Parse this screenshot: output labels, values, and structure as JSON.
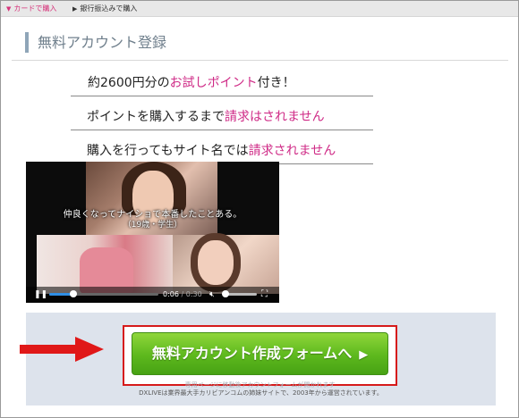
{
  "tabs": {
    "card": "カードで購入",
    "bank": "銀行振込みで購入"
  },
  "heading": "無料アカウント登録",
  "features": {
    "f1_pre": "約2600円分の",
    "f1_hl": "お試しポイント",
    "f1_post": "付き！",
    "f2_pre": "ポイントを購入するまで",
    "f2_hl": "請求はされません",
    "f3_pre": "購入を行ってもサイト名では",
    "f3_hl": "請求されません"
  },
  "video": {
    "subtitle_line1": "仲良くなってナイショで本番したことある。",
    "subtitle_line2": "（19歳・学生）",
    "time_current": "0:06",
    "time_separator": " / ",
    "time_total": "0:30",
    "progress": 0.22,
    "volume": 0.08,
    "icons": [
      "pause-icon",
      "mute-icon",
      "fullscreen-icon"
    ]
  },
  "cta": {
    "button_label": "無料アカウント作成フォームへ",
    "button_arrow": "▶",
    "fine_print_1": "専用ページに移動後アカウントフォームが開かれます",
    "fine_print_2": "DXLIVEは業界最大手カリビアンコムの姉妹サイトで、2003年から運営されています。"
  },
  "colors": {
    "highlight": "#cf2a86",
    "cta_green": "#5db81d",
    "callout_red": "#d61a1a",
    "panel_bg": "#dde3ec"
  }
}
